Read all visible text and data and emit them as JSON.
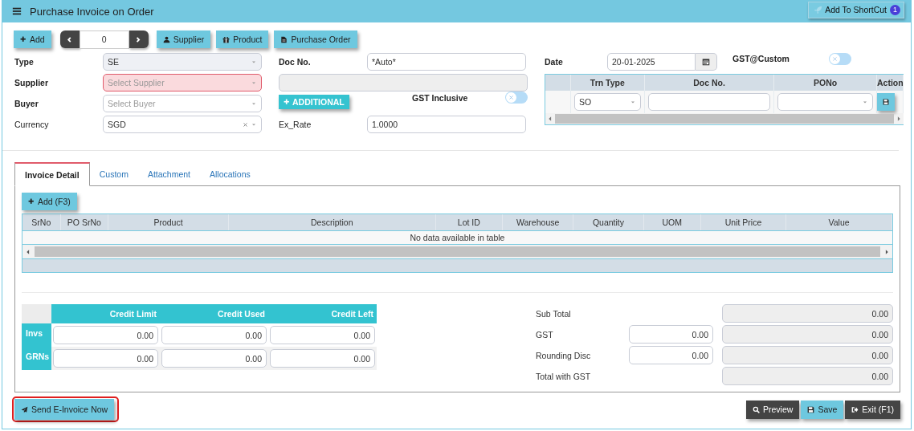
{
  "header": {
    "title": "Purchase Invoice on Order",
    "shortcut_button": "Add To ShortCut",
    "shortcut_badge": "1"
  },
  "toolbar": {
    "add_button": "Add",
    "record_number": "0",
    "buttons": [
      {
        "label": "Supplier"
      },
      {
        "label": "Product"
      },
      {
        "label": "Purchase Order"
      }
    ]
  },
  "form": {
    "left_fields": [
      {
        "label": "Type",
        "value": "SE",
        "disabled": true,
        "invalid": false,
        "clearable": false
      },
      {
        "label": "Supplier",
        "placeholder": "Select Supplier",
        "disabled": false,
        "invalid": true,
        "clearable": false
      },
      {
        "label": "Buyer",
        "placeholder": "Select Buyer",
        "disabled": false,
        "invalid": false,
        "clearable": false
      },
      {
        "label": "Currency",
        "value": "SGD",
        "disabled": false,
        "invalid": false,
        "clearable": true
      }
    ],
    "doc_no": {
      "label": "Doc No.",
      "value": "*Auto*"
    },
    "supplier_detail": {
      "disabled": true
    },
    "additional_button": "ADDITIONAL",
    "gst_inclusive": {
      "label": "GST Inclusive",
      "on": false
    },
    "ex_rate": {
      "label": "Ex_Rate",
      "value": "1.0000"
    },
    "date": {
      "label": "Date",
      "value": "20-01-2025"
    },
    "gst_custom": {
      "label": "GST@Custom",
      "on": false
    },
    "reference_table": {
      "columns": [
        "Trn Type",
        "Doc No.",
        "PONo",
        "Action"
      ],
      "rows": [
        {
          "trn_type": "SO"
        }
      ]
    }
  },
  "tabs": [
    {
      "label": "Invoice Detail",
      "selected": true
    },
    {
      "label": "Custom",
      "selected": false
    },
    {
      "label": "Attachment",
      "selected": false
    },
    {
      "label": "Allocations",
      "selected": false
    }
  ],
  "detail": {
    "add_button": "Add (F3)",
    "columns": [
      "SrNo",
      "PO SrNo",
      "Product",
      "Description",
      "Lot ID",
      "Warehouse",
      "Quantity",
      "UOM",
      "Unit Price",
      "Value"
    ],
    "empty_message": "No data available in table"
  },
  "credit": {
    "columns": [
      "Credit Limit",
      "Credit Used",
      "Credit Left"
    ],
    "rows": [
      {
        "label": "Invs",
        "values": [
          "0.00",
          "0.00",
          "0.00"
        ]
      },
      {
        "label": "GRNs",
        "values": [
          "0.00",
          "0.00",
          "0.00"
        ]
      }
    ]
  },
  "totals": [
    {
      "label": "Sub Total",
      "value": "0.00"
    },
    {
      "label": "GST",
      "input": "0.00",
      "value": "0.00"
    },
    {
      "label": "Rounding Disc",
      "input": "0.00",
      "value": "0.00"
    },
    {
      "label": "Total with GST",
      "value": "0.00"
    }
  ],
  "footer": {
    "send_button": {
      "label": "Send E-Invoice Now",
      "highlighted": true
    },
    "buttons": [
      {
        "label": "Preview",
        "kind": "dark"
      },
      {
        "label": "Save",
        "kind": "primary"
      },
      {
        "label": "Exit (F1)",
        "kind": "dark"
      }
    ]
  }
}
